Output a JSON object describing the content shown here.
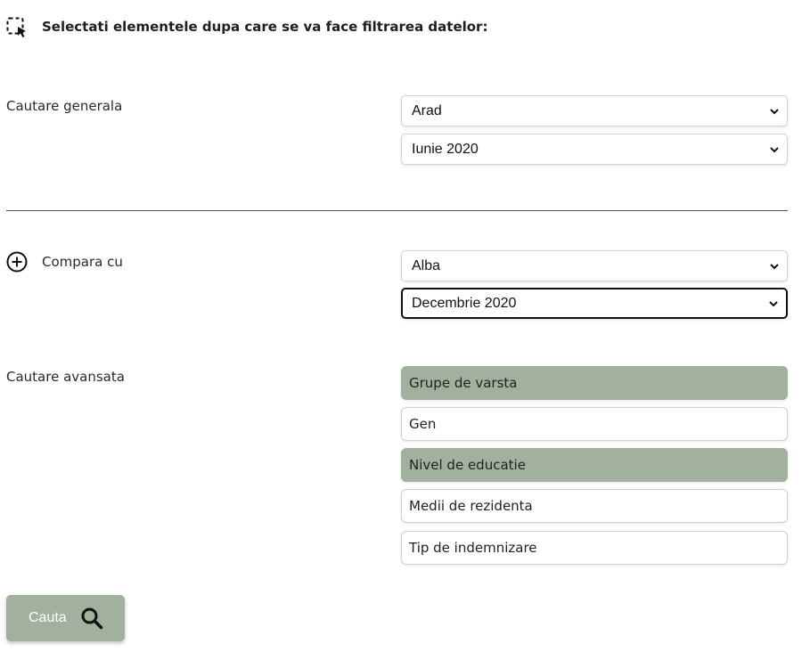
{
  "header": {
    "title": "Selectati elementele dupa care se va face filtrarea datelor:",
    "icon": "selection-cursor-icon"
  },
  "general_search": {
    "label": "Cautare generala",
    "county": "Arad",
    "period": "Iunie 2020"
  },
  "compare": {
    "label": "Compara cu",
    "icon": "plus-circle-icon",
    "county": "Alba",
    "period": "Decembrie 2020"
  },
  "advanced_search": {
    "label": "Cautare avansata",
    "options": [
      {
        "label": "Grupe de varsta",
        "selected": true
      },
      {
        "label": "Gen",
        "selected": false
      },
      {
        "label": "Nivel de educatie",
        "selected": true
      },
      {
        "label": "Medii de rezidenta",
        "selected": false
      },
      {
        "label": "Tip de indemnizare",
        "selected": false
      }
    ]
  },
  "search_button": {
    "label": "Cauta",
    "icon": "search-icon"
  },
  "colors": {
    "accent": "#a2b09e"
  }
}
